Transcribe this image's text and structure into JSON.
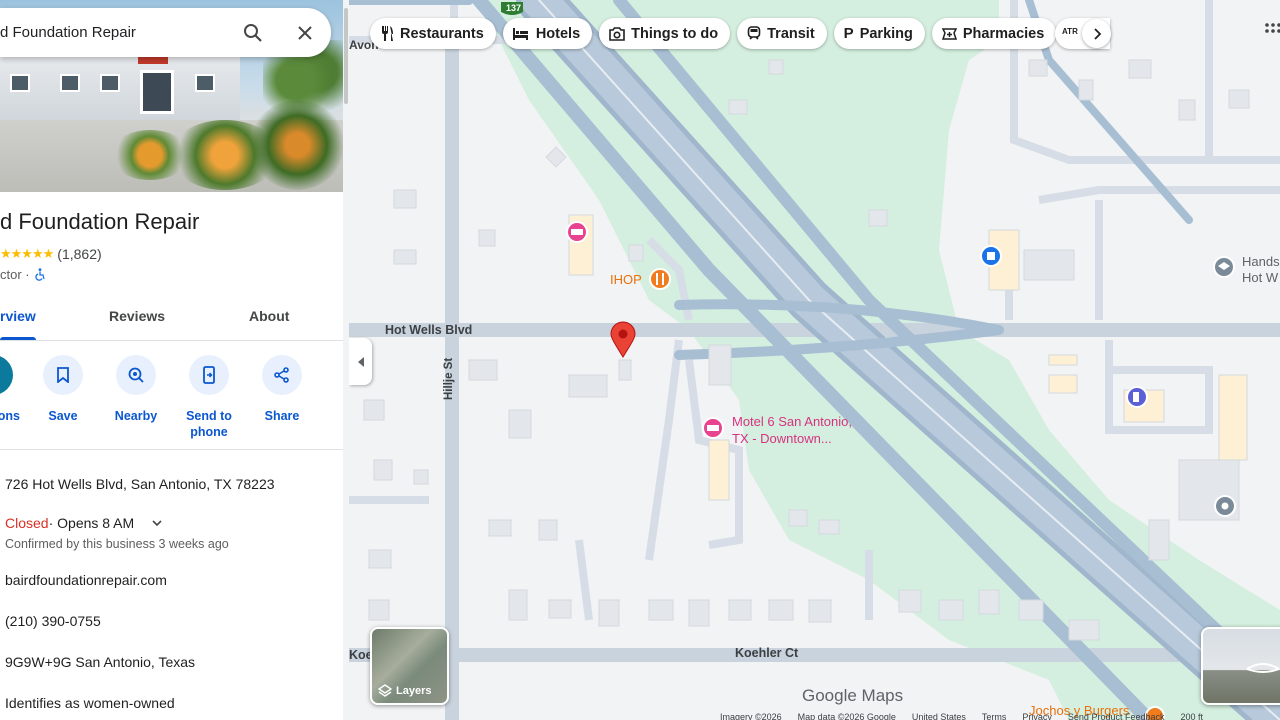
{
  "search": {
    "value": "d Foundation Repair"
  },
  "place": {
    "name": "d Foundation Repair",
    "stars": "★★★★★",
    "review_count": "(1,862)",
    "category": "ctor ·",
    "accessible_icon": "wheelchair-icon"
  },
  "tabs": [
    "rview",
    "Reviews",
    "About"
  ],
  "actions": [
    {
      "label": "ons",
      "icon": "directions-icon"
    },
    {
      "label": "Save",
      "icon": "bookmark-icon"
    },
    {
      "label": "Nearby",
      "icon": "nearby-icon"
    },
    {
      "label": "Send to phone",
      "label_line1": "Send to",
      "label_line2": "phone",
      "icon": "send-to-phone-icon"
    },
    {
      "label": "Share",
      "icon": "share-icon"
    }
  ],
  "info": {
    "address": "726 Hot Wells Blvd, San Antonio, TX 78223",
    "status_closed": "Closed",
    "status_hours": " · Opens 8 AM",
    "confirmed": "Confirmed by this business 3 weeks ago",
    "website": "bairdfoundationrepair.com",
    "phone": "(210) 390-0755",
    "plus_code": "9G9W+9G San Antonio, Texas",
    "identity": "Identifies as women-owned"
  },
  "chips": [
    {
      "label": "Restaurants",
      "icon": "fork-knife-icon"
    },
    {
      "label": "Hotels",
      "icon": "bed-icon"
    },
    {
      "label": "Things to do",
      "icon": "camera-icon"
    },
    {
      "label": "Transit",
      "icon": "train-icon"
    },
    {
      "label": "Parking",
      "icon": "parking-icon"
    },
    {
      "label": "Pharmacies",
      "icon": "pharmacy-icon"
    }
  ],
  "map_labels": {
    "road_hot_wells": "Hot Wells Blvd",
    "road_hillje": "Hillje St",
    "road_koehler": "Koehler Ct",
    "road_koe": "Koe",
    "road_avon": "Avondale",
    "road_avon_short": "Avon",
    "hwy_shield": "137",
    "ihop": "IHOP",
    "motel_line1": "Motel 6 San Antonio,",
    "motel_line2": "TX - Downtown...",
    "hands_line1": "Hands",
    "hands_line2": "Hot W",
    "jochos": "Jochos y Burgers",
    "more_chip_text": "ATR"
  },
  "layers_label": "Layers",
  "logo": "Google Maps",
  "footer": [
    "Imagery ©2026",
    "Map data ©2026 Google",
    "United States",
    "Terms",
    "Privacy",
    "Send Product Feedback",
    "200 ft"
  ],
  "colors": {
    "accent_blue": "#0b57d0",
    "closed_red": "#d93025",
    "park_green": "#d3f0df",
    "highway": "#9eb6cd",
    "pin_red": "#ea4335",
    "hotel_pink": "#e8438f",
    "food_orange": "#f07c1d"
  }
}
